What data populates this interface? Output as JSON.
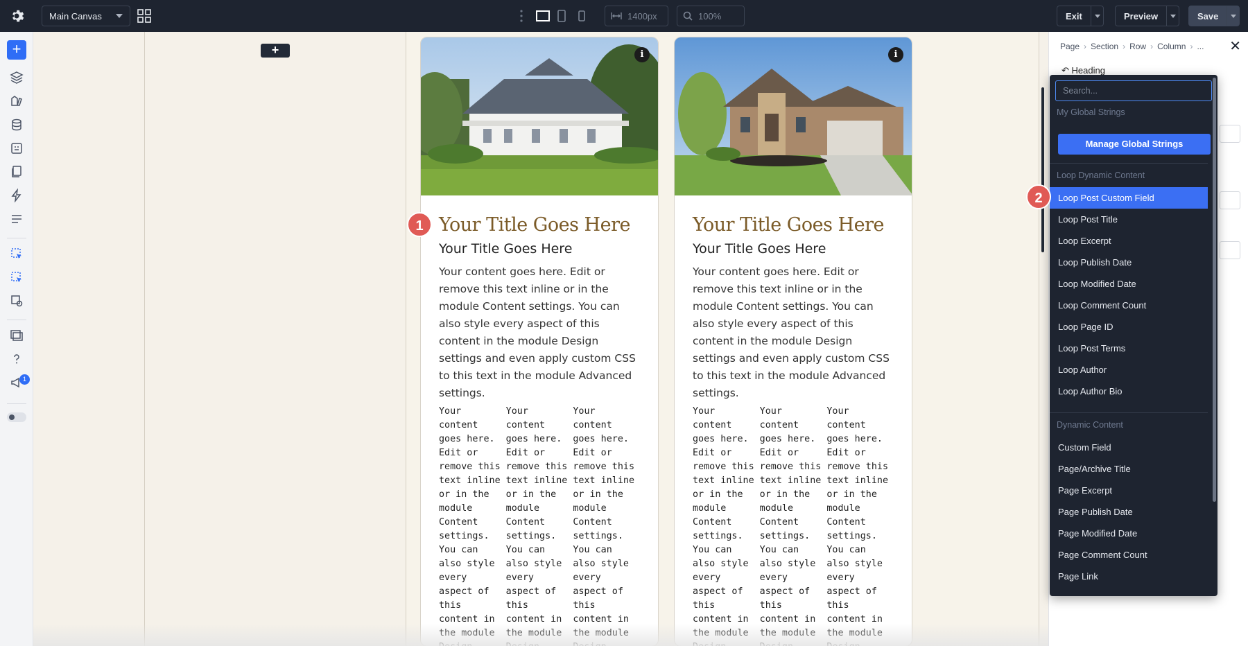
{
  "topbar": {
    "canvas_select": "Main Canvas",
    "width_value": "1400px",
    "zoom_value": "100%",
    "exit_label": "Exit",
    "preview_label": "Preview",
    "save_label": "Save"
  },
  "leftbar": {
    "notification_count": "1"
  },
  "canvas": {
    "cards": [
      {
        "title_serif": "Your Title Goes Here",
        "title_sans": "Your Title Goes Here",
        "body": "Your content goes here. Edit or remove this text inline or in the module Content settings. You can also style every aspect of this content in the module Design settings and even apply custom CSS to this text in the module Advanced settings.",
        "mono_text": "Your\ncontent\ngoes here.\nEdit or\nremove this\ntext inline\nor in the\nmodule\nContent\nsettings.\nYou can\nalso style\nevery\naspect of\nthis\ncontent in\nthe module\nDesign\nsettings"
      },
      {
        "title_serif": "Your Title Goes Here",
        "title_sans": "Your Title Goes Here",
        "body": "Your content goes here. Edit or remove this text inline or in the module Content settings. You can also style every aspect of this content in the module Design settings and even apply custom CSS to this text in the module Advanced settings.",
        "mono_text": "Your\ncontent\ngoes here.\nEdit or\nremove this\ntext inline\nor in the\nmodule\nContent\nsettings.\nYou can\nalso style\nevery\naspect of\nthis\ncontent in\nthe module\nDesign\nsettings"
      }
    ],
    "step1": "1",
    "step2": "2"
  },
  "panel": {
    "breadcrumb": [
      "Page",
      "Section",
      "Row",
      "Column",
      "..."
    ],
    "heading": "Heading"
  },
  "dropdown": {
    "search_placeholder": "Search...",
    "my_global_strings": "My Global Strings",
    "manage_button": "Manage Global Strings",
    "loop_section": "Loop Dynamic Content",
    "loop_items": [
      "Loop Post Custom Field",
      "Loop Post Title",
      "Loop Excerpt",
      "Loop Publish Date",
      "Loop Modified Date",
      "Loop Comment Count",
      "Loop Page ID",
      "Loop Post Terms",
      "Loop Author",
      "Loop Author Bio"
    ],
    "dynamic_section": "Dynamic Content",
    "dynamic_items": [
      "Custom Field",
      "Page/Archive Title",
      "Page Excerpt",
      "Page Publish Date",
      "Page Modified Date",
      "Page Comment Count",
      "Page Link"
    ]
  },
  "colors": {
    "accent": "#3b6ff3",
    "topbar_bg": "#1e2430",
    "step_badge": "#e05a55",
    "serif_title": "#7b5b28"
  }
}
